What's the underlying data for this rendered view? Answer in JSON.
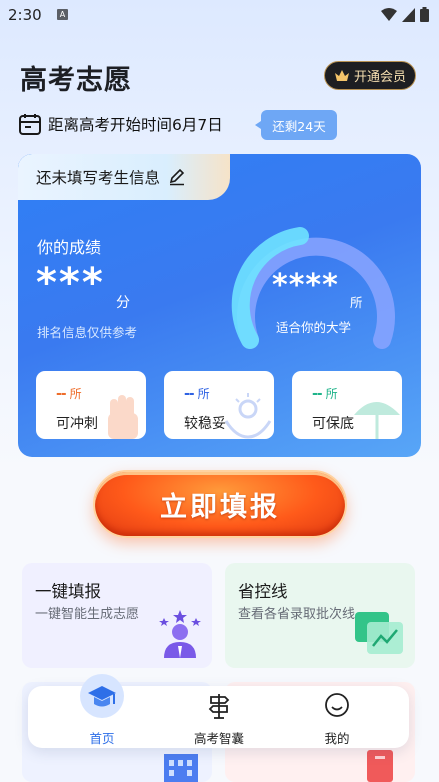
{
  "status_bar": {
    "time": "2:30",
    "notif": "A"
  },
  "header": {
    "title": "高考志愿",
    "vip_label": "开通会员"
  },
  "countdown": {
    "text": "距离高考开始时间6月7日",
    "remain": "还剩24天"
  },
  "card": {
    "tab_text": "还未填写考生信息",
    "score_label": "你的成绩",
    "score_value": "***",
    "score_unit": "分",
    "rank_note": "排名信息仅供参考",
    "match_value": "****",
    "match_unit": "所",
    "match_label": "适合你的大学",
    "tiers": [
      {
        "dash": "--",
        "unit": "所",
        "name": "可冲刺",
        "color": "#ee6d2b"
      },
      {
        "dash": "--",
        "unit": "所",
        "name": "较稳妥",
        "color": "#2f62e3"
      },
      {
        "dash": "--",
        "unit": "所",
        "name": "可保底",
        "color": "#1fb48a"
      }
    ]
  },
  "cta": {
    "label": "立即填报"
  },
  "features": [
    {
      "title": "一键填报",
      "desc": "一键智能生成志愿"
    },
    {
      "title": "省控线",
      "desc": "查看各省录取批次线"
    }
  ],
  "tabbar": {
    "items": [
      {
        "label": "首页"
      },
      {
        "label": "高考智囊"
      },
      {
        "label": "我的"
      }
    ]
  },
  "colors": {
    "primary": "#2e6fe8",
    "accent": "#ff5a1a"
  }
}
